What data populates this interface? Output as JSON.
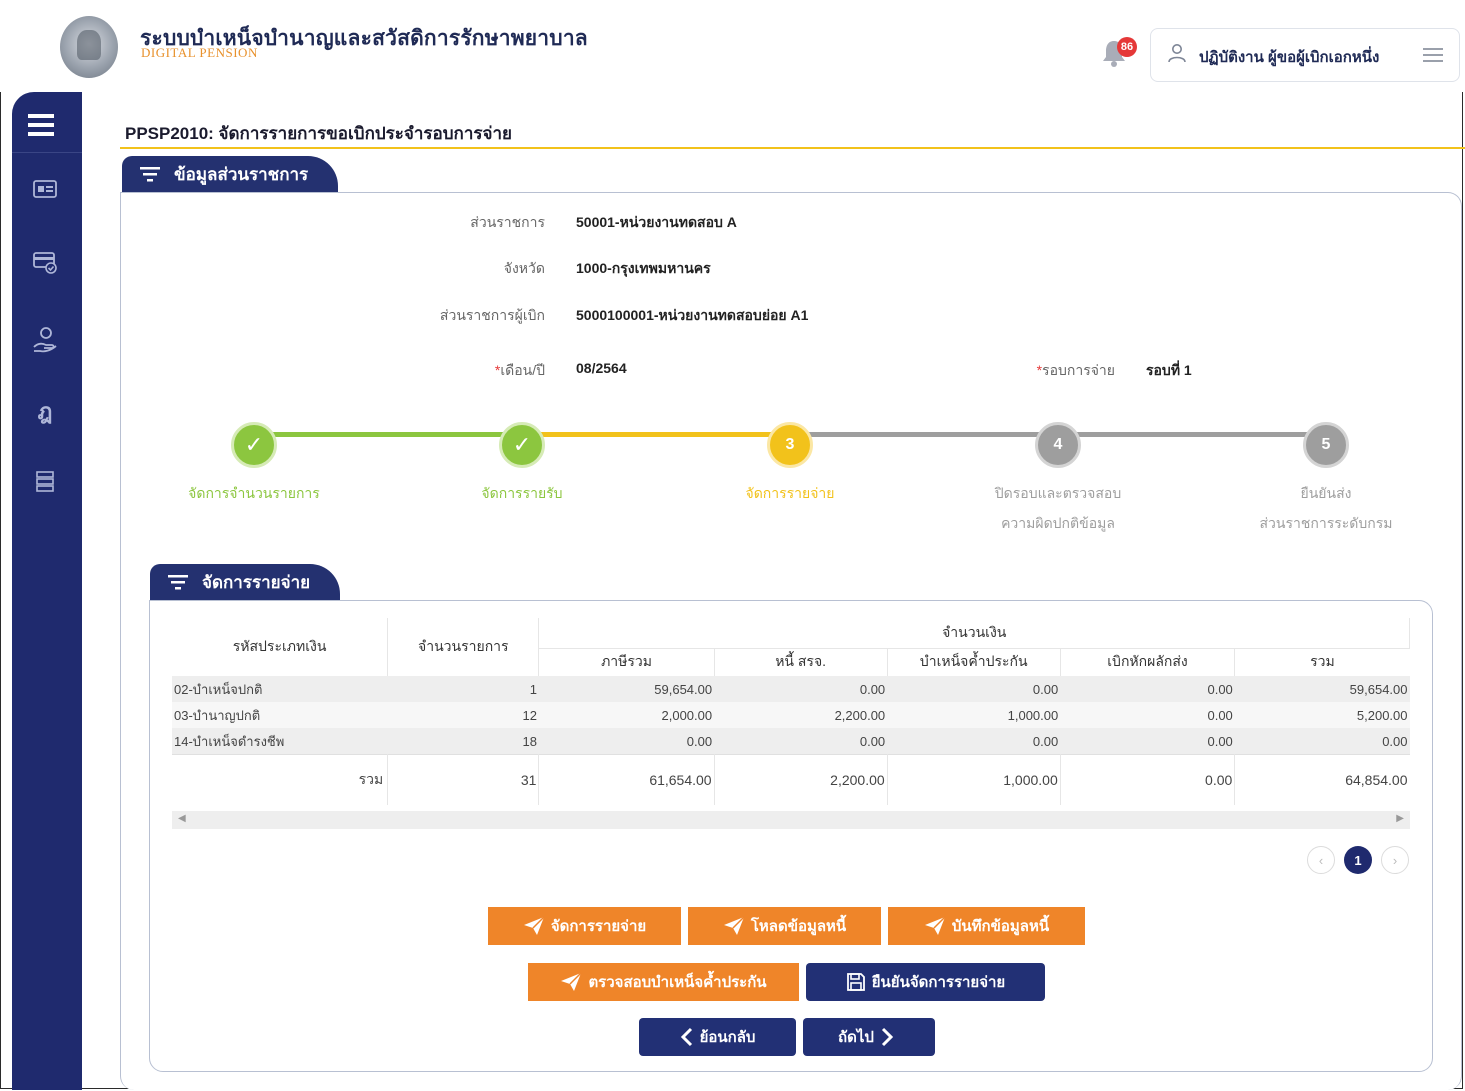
{
  "header": {
    "app_title": "ระบบบำเหน็จบำนาญและสวัสดิการรักษาพยาบาล",
    "app_subtitle": "DIGITAL PENSION",
    "notification_count": "86",
    "user_label": "ปฏิบัติงาน ผู้ขอผู้เบิกเอกหนึ่ง"
  },
  "page": {
    "title": "PPSP2010: จัดการรายการขอเบิกประจำรอบการจ่าย"
  },
  "agency_section": {
    "tab_label": "ข้อมูลส่วนราชการ",
    "fields": {
      "agency_label": "ส่วนราชการ",
      "agency_value": "50001-หน่วยงานทดสอบ A",
      "province_label": "จังหวัด",
      "province_value": "1000-กรุงเทพมหานคร",
      "disbursing_label": "ส่วนราชการผู้เบิก",
      "disbursing_value": "5000100001-หน่วยงานทดสอบย่อย A1",
      "month_label": "เดือน/ปี",
      "month_value": "08/2564",
      "round_label": "รอบการจ่าย",
      "round_value": "รอบที่ 1"
    }
  },
  "stepper": {
    "steps": [
      {
        "number": "✓",
        "label_1": "จัดการจำนวนรายการ",
        "label_2": "",
        "state": "done"
      },
      {
        "number": "✓",
        "label_1": "จัดการรายรับ",
        "label_2": "",
        "state": "done"
      },
      {
        "number": "3",
        "label_1": "จัดการรายจ่าย",
        "label_2": "",
        "state": "current"
      },
      {
        "number": "4",
        "label_1": "ปิดรอบและตรวจสอบ",
        "label_2": "ความผิดปกติข้อมูล",
        "state": "todo"
      },
      {
        "number": "5",
        "label_1": "ยืนยันส่ง",
        "label_2": "ส่วนราชการระดับกรม",
        "state": "todo"
      }
    ],
    "colors": {
      "done": "#8cc63f",
      "current": "#f2c21b",
      "todo": "#9e9e9e"
    }
  },
  "expense_section": {
    "tab_label": "จัดการรายจ่าย",
    "table": {
      "header_type": "รหัสประเภทเงิน",
      "header_count": "จำนวนรายการ",
      "header_amount_group": "จำนวนเงิน",
      "columns": [
        "ภาษีรวม",
        "หนี้ สรจ.",
        "บำเหน็จค้ำประกัน",
        "เบิกหักผลักส่ง",
        "รวม"
      ],
      "rows": [
        {
          "type": "02-บำเหน็จปกติ",
          "count": "1",
          "tax": "59,654.00",
          "debt": "0.00",
          "guarantee": "0.00",
          "deduct": "0.00",
          "total": "59,654.00"
        },
        {
          "type": "03-บำนาญปกติ",
          "count": "12",
          "tax": "2,000.00",
          "debt": "2,200.00",
          "guarantee": "1,000.00",
          "deduct": "0.00",
          "total": "5,200.00"
        },
        {
          "type": "14-บำเหน็จดำรงชีพ",
          "count": "18",
          "tax": "0.00",
          "debt": "0.00",
          "guarantee": "0.00",
          "deduct": "0.00",
          "total": "0.00"
        }
      ],
      "totals": {
        "label": "รวม",
        "count": "31",
        "tax": "61,654.00",
        "debt": "2,200.00",
        "guarantee": "1,000.00",
        "deduct": "0.00",
        "total": "64,854.00"
      }
    },
    "pagination": {
      "current_page": "1"
    }
  },
  "actions": {
    "manage_expense": "จัดการรายจ่าย",
    "load_debt": "โหลดข้อมูลหนี้",
    "save_debt": "บันทึกข้อมูลหนี้",
    "check_guarantee": "ตรวจสอบบำเหน็จค้ำประกัน",
    "confirm_expense": "ยืนยันจัดการรายจ่าย",
    "back": "ย้อนกลับ",
    "next": "ถัดไป"
  }
}
